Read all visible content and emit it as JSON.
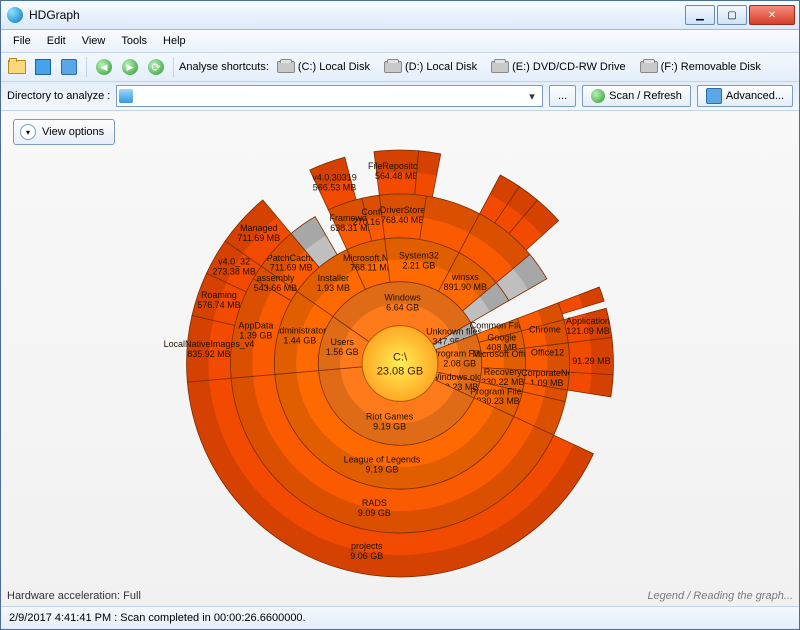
{
  "window": {
    "title": "HDGraph"
  },
  "menu": [
    "File",
    "Edit",
    "View",
    "Tools",
    "Help"
  ],
  "shortcuts_label": "Analyse shortcuts:",
  "shortcuts": [
    {
      "label": "(C:) Local Disk"
    },
    {
      "label": "(D:) Local Disk"
    },
    {
      "label": "(E:) DVD/CD-RW Drive"
    },
    {
      "label": "(F:) Removable Disk"
    }
  ],
  "dir_label": "Directory to analyze :",
  "dir_value": "",
  "browse_label": "...",
  "scan_label": "Scan / Refresh",
  "advanced_label": "Advanced...",
  "view_options_label": "View options",
  "hw_label": "Hardware acceleration: Full",
  "legend_label": "Legend / Reading the graph...",
  "status": "2/9/2017 4:41:41 PM : Scan completed in 00:00:26.6600000.",
  "chart_data": {
    "type": "sunburst",
    "center": {
      "name": "C:\\",
      "size": "23.08 GB"
    },
    "rings": [
      [
        {
          "name": "Windows",
          "size": "6.64 GB",
          "start": -55,
          "sweep": 115,
          "color": "#ff7a1a"
        },
        {
          "name": "Unknown files",
          "size": "347.95 MB",
          "start": 60,
          "sweep": 9,
          "color": "#b0b0b0",
          "gray": true
        },
        {
          "name": "Program Files",
          "size": "2.08 GB",
          "start": 69,
          "sweep": 34,
          "color": "#ff7a1a"
        },
        {
          "name": "Windows.old",
          "size": "230.23 MB",
          "start": 103,
          "sweep": 12,
          "color": "#ff7a1a"
        },
        {
          "name": "Riot Games",
          "size": "9.19 GB",
          "start": 115,
          "sweep": 150,
          "color": "#ff7a1a"
        },
        {
          "name": "Users",
          "size": "1.56 GB",
          "start": 265,
          "sweep": 40,
          "color": "#ff7a1a"
        }
      ],
      [
        {
          "name": "Installer",
          "size": "1.93 MB",
          "start": -55,
          "sweep": 30,
          "color": "#ff6a00"
        },
        {
          "name": "Microsoft.NET",
          "size": "768.11 MB",
          "start": -25,
          "sweep": 18,
          "color": "#ff6a00"
        },
        {
          "name": "System32",
          "size": "2.21 GB",
          "start": -7,
          "sweep": 35,
          "color": "#ff6a00"
        },
        {
          "name": "winsxs",
          "size": "891.90 MB",
          "start": 28,
          "sweep": 22,
          "color": "#ff6a00"
        },
        {
          "name": "",
          "size": "",
          "start": 50,
          "sweep": 10,
          "color": "#b0b0b0",
          "gray": true
        },
        {
          "name": "Common Files",
          "size": "",
          "start": 69,
          "sweep": 6,
          "color": "#ff6a00"
        },
        {
          "name": "Google",
          "size": "408 MB",
          "start": 75,
          "sweep": 8,
          "color": "#ff6a00"
        },
        {
          "name": "Microsoft Office",
          "size": "",
          "start": 83,
          "sweep": 10,
          "color": "#ff6a00"
        },
        {
          "name": "Recovery",
          "size": "230.22 MB",
          "start": 93,
          "sweep": 10,
          "color": "#ff6a00"
        },
        {
          "name": "Program Files",
          "size": "230.23 MB",
          "start": 103,
          "sweep": 12,
          "color": "#ff6a00"
        },
        {
          "name": "League of Legends",
          "size": "9.19 GB",
          "start": 115,
          "sweep": 150,
          "color": "#ff6a00"
        },
        {
          "name": "Administrator",
          "size": "1.44 GB",
          "start": 265,
          "sweep": 40,
          "color": "#ff6a00"
        }
      ],
      [
        {
          "name": "$PatchCache$",
          "size": "711.69 MB",
          "start": -55,
          "sweep": 15,
          "color": "#fa5a00"
        },
        {
          "name": "",
          "size": "",
          "start": -40,
          "sweep": 10,
          "color": "#b0b0b0",
          "gray": true
        },
        {
          "name": "Framework",
          "size": "638.31 MB",
          "start": -25,
          "sweep": 12,
          "color": "#fa5a00"
        },
        {
          "name": "Config",
          "size": "270.16 MB",
          "start": -13,
          "sweep": 6,
          "color": "#fa5a00"
        },
        {
          "name": "DriverStore",
          "size": "768.40 MB",
          "start": -7,
          "sweep": 16,
          "color": "#fa5a00"
        },
        {
          "name": "",
          "size": "",
          "start": 9,
          "sweep": 19,
          "color": "#fa5a00"
        },
        {
          "name": "",
          "size": "",
          "start": 28,
          "sweep": 22,
          "color": "#fa5a00"
        },
        {
          "name": "",
          "size": "",
          "start": 50,
          "sweep": 10,
          "color": "#b0b0b0",
          "gray": true
        },
        {
          "name": "",
          "size": "",
          "start": 69,
          "sweep": 6,
          "color": "#fa5a00"
        },
        {
          "name": "Chrome",
          "size": "",
          "start": 75,
          "sweep": 8,
          "color": "#fa5a00"
        },
        {
          "name": "Office12",
          "size": "",
          "start": 83,
          "sweep": 10,
          "color": "#fa5a00"
        },
        {
          "name": "CorporateNe",
          "size": "1.09 MB",
          "start": 93,
          "sweep": 6,
          "color": "#fa5a00"
        },
        {
          "name": "",
          "size": "",
          "start": 99,
          "sweep": 4,
          "color": "#fa5a00"
        },
        {
          "name": "",
          "size": "",
          "start": 103,
          "sweep": 12,
          "color": "#fa5a00"
        },
        {
          "name": "RADS",
          "size": "9.09 GB",
          "start": 115,
          "sweep": 150,
          "color": "#fa5a00"
        },
        {
          "name": "AppData",
          "size": "1.39 GB",
          "start": 265,
          "sweep": 35,
          "color": "#fa5a00"
        },
        {
          "name": "assembly",
          "size": "543.66 MB",
          "start": 300,
          "sweep": 5,
          "color": "#fa5a00"
        }
      ],
      [
        {
          "name": "Managed",
          "size": "711.69 MB",
          "start": -55,
          "sweep": 15,
          "color": "#f24a00"
        },
        {
          "name": "v4.0.30319",
          "size": "566.53 MB",
          "start": -25,
          "sweep": 10,
          "color": "#f24a00"
        },
        {
          "name": "FileRepository",
          "size": "564.48 MB",
          "start": -7,
          "sweep": 12,
          "color": "#f24a00"
        },
        {
          "name": "",
          "size": "",
          "start": 5,
          "sweep": 6,
          "color": "#f24a00"
        },
        {
          "name": "",
          "size": "",
          "start": 28,
          "sweep": 6,
          "color": "#f24a00"
        },
        {
          "name": "",
          "size": "",
          "start": 34,
          "sweep": 6,
          "color": "#f24a00"
        },
        {
          "name": "",
          "size": "",
          "start": 40,
          "sweep": 8,
          "color": "#f24a00"
        },
        {
          "name": "",
          "size": "",
          "start": 69,
          "sweep": 4,
          "color": "#f24a00"
        },
        {
          "name": "Application",
          "size": "121.09 MB",
          "start": 75,
          "sweep": 8,
          "color": "#f24a00"
        },
        {
          "name": "",
          "size": "91.29 MB",
          "start": 83,
          "sweep": 10,
          "color": "#f24a00"
        },
        {
          "name": "",
          "size": "",
          "start": 93,
          "sweep": 6,
          "color": "#f24a00"
        },
        {
          "name": "projects",
          "size": "9.06 GB",
          "start": 115,
          "sweep": 150,
          "color": "#f24a00"
        },
        {
          "name": "LocalNativeImages_v4",
          "size": "835.92 MB",
          "start": 265,
          "sweep": 18,
          "color": "#f24a00"
        },
        {
          "name": "Roaming",
          "size": "576.74 MB",
          "start": 283,
          "sweep": 12,
          "color": "#f24a00"
        },
        {
          "name": "v4.0_32",
          "size": "273.38 MB",
          "start": 295,
          "sweep": 10,
          "color": "#f24a00"
        }
      ]
    ]
  }
}
